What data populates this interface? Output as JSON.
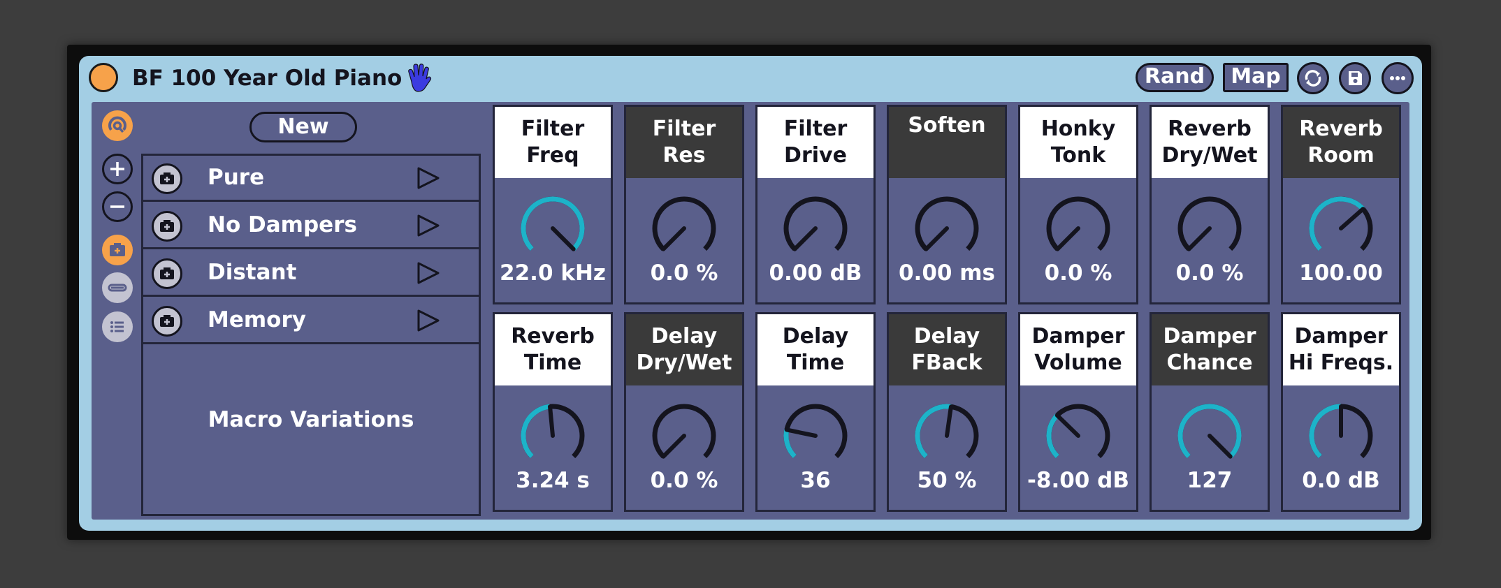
{
  "device": {
    "title": "BF 100 Year Old Piano",
    "buttons": {
      "rand": "Rand",
      "map": "Map"
    }
  },
  "colors": {
    "accent": "#1db3c9",
    "knob_track": "#14141e",
    "body": "#5a5f8b",
    "title_bar": "#a3cee4",
    "power": "#f7a24a"
  },
  "variations": {
    "new_label": "New",
    "items": [
      {
        "label": "Pure"
      },
      {
        "label": "No Dampers"
      },
      {
        "label": "Distant"
      },
      {
        "label": "Memory"
      }
    ],
    "panel_label": "Macro Variations"
  },
  "macros": [
    {
      "label": "Filter\nFreq",
      "value": "22.0 kHz",
      "level": 1.0,
      "header": "light"
    },
    {
      "label": "Filter\nRes",
      "value": "0.0 %",
      "level": 0.0,
      "header": "dark"
    },
    {
      "label": "Filter\nDrive",
      "value": "0.00 dB",
      "level": 0.0,
      "header": "light"
    },
    {
      "label": "Soften",
      "value": "0.00 ms",
      "level": 0.0,
      "header": "dark"
    },
    {
      "label": "Honky\nTonk",
      "value": "0.0 %",
      "level": 0.0,
      "header": "light"
    },
    {
      "label": "Reverb\nDry/Wet",
      "value": "0.0 %",
      "level": 0.0,
      "header": "light"
    },
    {
      "label": "Reverb\nRoom",
      "value": "100.00",
      "level": 0.68,
      "header": "dark"
    },
    {
      "label": "Reverb\nTime",
      "value": "3.24 s",
      "level": 0.48,
      "header": "light"
    },
    {
      "label": "Delay\nDry/Wet",
      "value": "0.0 %",
      "level": 0.0,
      "header": "dark"
    },
    {
      "label": "Delay\nTime",
      "value": "36",
      "level": 0.21,
      "header": "light"
    },
    {
      "label": "Delay\nFBack",
      "value": "50 %",
      "level": 0.53,
      "header": "dark"
    },
    {
      "label": "Damper\nVolume",
      "value": "-8.00 dB",
      "level": 0.33,
      "header": "light"
    },
    {
      "label": "Damper\nChance",
      "value": "127",
      "level": 1.0,
      "header": "dark"
    },
    {
      "label": "Damper\nHi Freqs.",
      "value": "0.0 dB",
      "level": 0.5,
      "header": "light"
    }
  ]
}
